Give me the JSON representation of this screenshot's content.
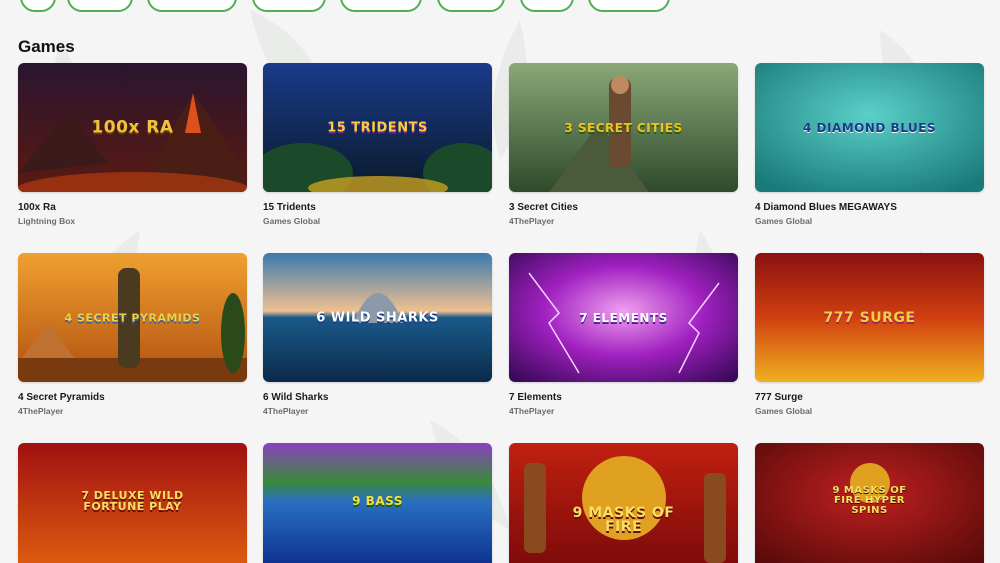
{
  "section": {
    "title": "Games"
  },
  "filters": [
    {
      "label": ""
    },
    {
      "label": ""
    },
    {
      "label": ""
    },
    {
      "label": ""
    },
    {
      "label": ""
    },
    {
      "label": ""
    },
    {
      "label": ""
    },
    {
      "label": ""
    }
  ],
  "games": [
    {
      "title": "100x Ra",
      "provider": "Lightning Box",
      "logo": "100x RA",
      "theme": "volcano"
    },
    {
      "title": "15 Tridents",
      "provider": "Games Global",
      "logo": "15 TRIDENTS",
      "theme": "underwater"
    },
    {
      "title": "3 Secret Cities",
      "provider": "4ThePlayer",
      "logo": "3 SECRET CITIES",
      "theme": "jungle"
    },
    {
      "title": "4 Diamond Blues MEGAWAYS",
      "provider": "Games Global",
      "logo": "4 DIAMOND BLUES",
      "theme": "teal"
    },
    {
      "title": "4 Secret Pyramids",
      "provider": "4ThePlayer",
      "logo": "4 SECRET PYRAMIDS",
      "theme": "desert"
    },
    {
      "title": "6 Wild Sharks",
      "provider": "4ThePlayer",
      "logo": "6 WILD SHARKS",
      "theme": "ocean"
    },
    {
      "title": "7 Elements",
      "provider": "4ThePlayer",
      "logo": "7 ELEMENTS",
      "theme": "purple"
    },
    {
      "title": "777 Surge",
      "provider": "Games Global",
      "logo": "777 SURGE",
      "theme": "fire"
    },
    {
      "title": "",
      "provider": "",
      "logo": "7 DELUXE WILD FORTUNE PLAY",
      "theme": "redfire"
    },
    {
      "title": "",
      "provider": "",
      "logo": "9 BASS",
      "theme": "lake"
    },
    {
      "title": "",
      "provider": "",
      "logo": "9 MASKS OF FIRE",
      "theme": "masks"
    },
    {
      "title": "",
      "provider": "",
      "logo": "9 MASKS OF FIRE HYPER SPINS",
      "theme": "darkred"
    }
  ],
  "colors": {
    "accent": "#4caf50",
    "background": "#f4f5f4"
  }
}
